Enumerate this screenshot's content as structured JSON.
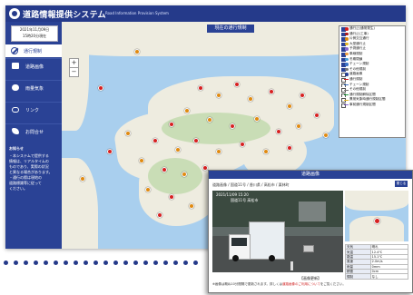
{
  "app": {
    "title": "道路情報提供システム",
    "subtitle": "Road Information Provision System",
    "date_line1": "2021年11月09日",
    "date_line2": "15時20分現在"
  },
  "sidebar": {
    "home_label": "通行規制",
    "items": [
      {
        "label": "道路画像",
        "icon": "road-image-icon"
      },
      {
        "label": "雨量気象",
        "icon": "weather-icon"
      },
      {
        "label": "リンク",
        "icon": "link-icon"
      },
      {
        "label": "お問合せ",
        "icon": "phone-icon"
      }
    ],
    "notice_title": "お知らせ",
    "notice_lines": [
      "・本システムで提供する",
      "情報は、リアルタイムの",
      "ものであり、実際の状況",
      "と異なる場合があります。",
      "・通行の際は現地の",
      "道路標識等に従って",
      "ください。"
    ]
  },
  "map": {
    "title": "現在の通行規制",
    "zoom_in": "+",
    "zoom_out": "−",
    "legend": [
      {
        "label": "通行止(通常発生)",
        "checked": true,
        "color": "#d72020",
        "kind": "dot"
      },
      {
        "label": "通行止(工事)",
        "checked": true,
        "color": "#b01818",
        "kind": "dot"
      },
      {
        "label": "片側交互通行",
        "checked": true,
        "color": "#e08a10",
        "kind": "dot"
      },
      {
        "label": "大型通行止",
        "checked": true,
        "color": "#e5b520",
        "kind": "dot"
      },
      {
        "label": "予測通行止",
        "checked": true,
        "color": "#8a6bd0",
        "kind": "dot"
      },
      {
        "label": "車線規制",
        "checked": true,
        "color": "#f0a040",
        "kind": "dot"
      },
      {
        "label": "冬期閉鎖",
        "checked": true,
        "color": "#4aa0d8",
        "kind": "dot"
      },
      {
        "label": "チェーン規制",
        "checked": true,
        "color": "#3c74c8",
        "kind": "dot"
      },
      {
        "label": "その他規制",
        "checked": true,
        "color": "#777777",
        "kind": "dot"
      },
      {
        "label": "道路画像",
        "checked": false,
        "color": "#2a4295",
        "kind": "dot"
      },
      {
        "label": "通行規制",
        "checked": false,
        "color": "#d72020",
        "kind": "line"
      },
      {
        "label": "チェーン規制",
        "checked": false,
        "color": "#3c74c8",
        "kind": "line"
      },
      {
        "label": "その他規制",
        "checked": false,
        "color": "#777777",
        "kind": "line"
      },
      {
        "label": "通行規制解除区間",
        "checked": false,
        "color": "#20a040",
        "kind": "line"
      },
      {
        "label": "異常気象時通行規制区間",
        "checked": false,
        "color": "#e5b520",
        "kind": "line"
      },
      {
        "label": "事前通行規制区間",
        "checked": false,
        "color": "#8a6bd0",
        "kind": "line"
      }
    ]
  },
  "popup": {
    "title": "道路画像",
    "path": "道路画像 / 国道11号 / 香川県 / 高松市 / 栗林町",
    "button": "閉じる",
    "cam_time": "2021/11/09 15:20",
    "cam_location": "国道11号 高松市",
    "table": [
      {
        "k": "天気",
        "v": "晴れ"
      },
      {
        "k": "気温",
        "v": "12.4℃"
      },
      {
        "k": "路温",
        "v": "15.1℃"
      },
      {
        "k": "風速",
        "v": "2.0m/s"
      },
      {
        "k": "雨量",
        "v": "0mm"
      },
      {
        "k": "積雪",
        "v": "0cm"
      },
      {
        "k": "規制",
        "v": "なし"
      }
    ],
    "caption": "【画像更新】",
    "footnote_a": "※画像は概ね10分間隔で更新されます。詳しくは",
    "footnote_link": "道路画像のご利用について",
    "footnote_b": "をご覧ください。"
  }
}
